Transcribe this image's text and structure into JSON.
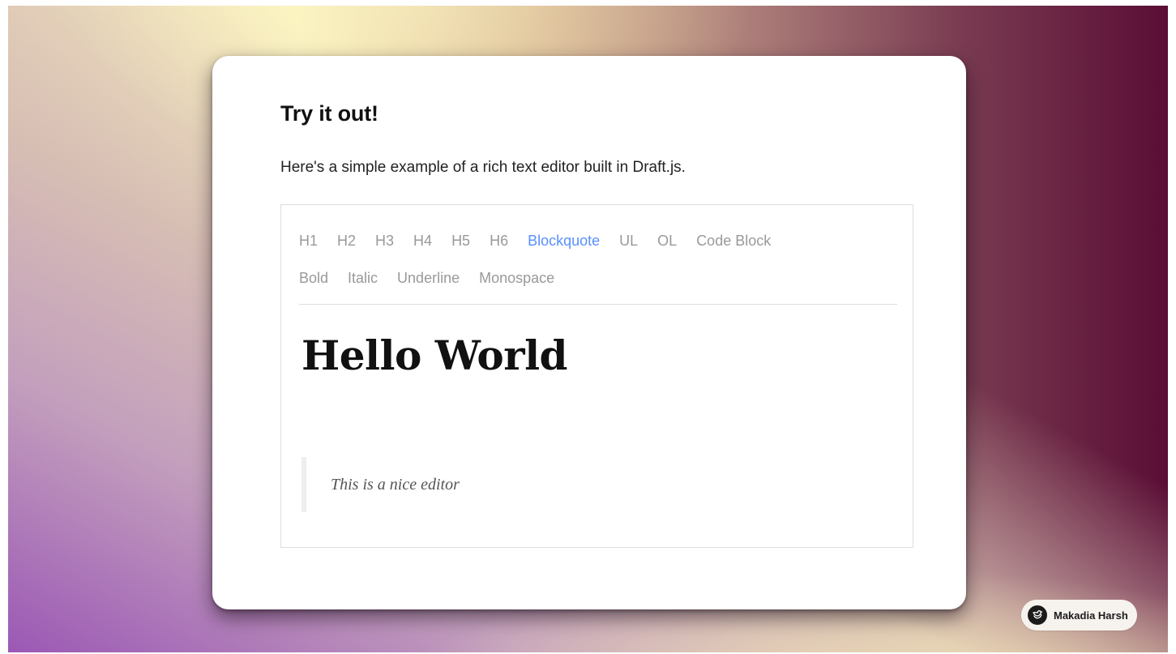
{
  "card": {
    "title": "Try it out!",
    "description": "Here's a simple example of a rich text editor built in Draft.js."
  },
  "editor": {
    "block_controls": [
      {
        "label": "H1",
        "active": false
      },
      {
        "label": "H2",
        "active": false
      },
      {
        "label": "H3",
        "active": false
      },
      {
        "label": "H4",
        "active": false
      },
      {
        "label": "H5",
        "active": false
      },
      {
        "label": "H6",
        "active": false
      },
      {
        "label": "Blockquote",
        "active": true
      },
      {
        "label": "UL",
        "active": false
      },
      {
        "label": "OL",
        "active": false
      },
      {
        "label": "Code Block",
        "active": false
      }
    ],
    "inline_controls": [
      {
        "label": "Bold",
        "active": false
      },
      {
        "label": "Italic",
        "active": false
      },
      {
        "label": "Underline",
        "active": false
      },
      {
        "label": "Monospace",
        "active": false
      }
    ],
    "content": {
      "heading": "Hello World",
      "blockquote": "This is a nice editor"
    }
  },
  "badge": {
    "name": "Makadia Harsh",
    "icon": "bird-logo-icon"
  },
  "colors": {
    "active_control": "#5890ff",
    "inactive_control": "#999999",
    "gradient_start": "#9b58b5",
    "gradient_end": "#5a0d35"
  }
}
